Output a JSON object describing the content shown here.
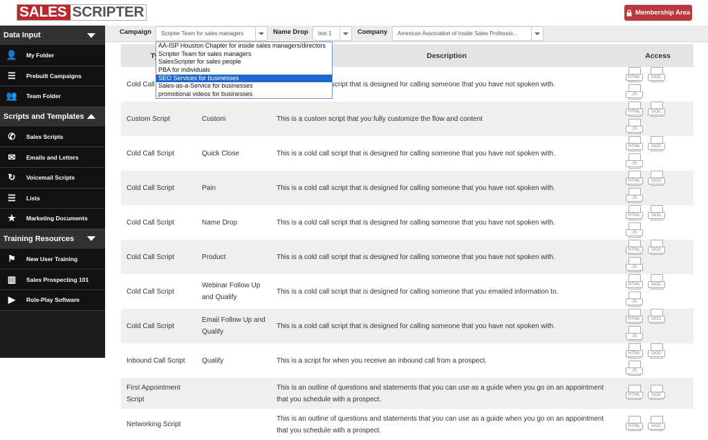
{
  "header": {
    "logo_part1": "SALES",
    "logo_part2": "SCRIPTER",
    "membership_label": "Membership Area",
    "membership_icon": "lock-icon"
  },
  "sidebar": {
    "sections": [
      {
        "title": "Data Input",
        "arrow": "down",
        "items": [
          {
            "label": "My Folder",
            "icon": "user-icon"
          },
          {
            "label": "Prebuilt Campaigns",
            "icon": "list-icon"
          },
          {
            "label": "Team Folder",
            "icon": "team-icon"
          }
        ]
      },
      {
        "title": "Scripts and Templates",
        "arrow": "up",
        "items": [
          {
            "label": "Sales Scripts",
            "icon": "phone-icon"
          },
          {
            "label": "Emails and Letters",
            "icon": "envelope-icon"
          },
          {
            "label": "Voicemail Scripts",
            "icon": "voicemail-icon"
          },
          {
            "label": "Lists",
            "icon": "list-icon"
          },
          {
            "label": "Marketing Documents",
            "icon": "star-icon"
          }
        ]
      },
      {
        "title": "Training Resources",
        "arrow": "down",
        "items": [
          {
            "label": "New User Training",
            "icon": "flag-icon"
          },
          {
            "label": "Sales Prospecting 101",
            "icon": "sliders-icon"
          },
          {
            "label": "Role-Play Software",
            "icon": "play-icon"
          }
        ]
      }
    ]
  },
  "filters": {
    "campaign_label": "Campaign",
    "campaign_value": "Scripter Team for sales managers",
    "namedrop_label": "Name Drop",
    "namedrop_value": "test 1",
    "company_label": "Company",
    "company_value": "American Association of Inside Sales Professio..."
  },
  "campaign_options": [
    {
      "label": "AA-ISP Houston Chapter for inside sales managers/directors",
      "highlighted": false
    },
    {
      "label": "Scripter Team for sales managers",
      "highlighted": false
    },
    {
      "label": "SalesScripter for sales people",
      "highlighted": false
    },
    {
      "label": "PBA for individuals",
      "highlighted": false
    },
    {
      "label": "SEO Services for businesses",
      "highlighted": true
    },
    {
      "label": "Sales-as-a-Service for businesses",
      "highlighted": false
    },
    {
      "label": "promotional videos for businesses",
      "highlighted": false
    }
  ],
  "table": {
    "headers": [
      "Type",
      "",
      "Description",
      "Access"
    ],
    "rows": [
      {
        "type": "Cold Call Script",
        "name": "",
        "description": "This is a cold call script that is designed for calling someone that you have not spoken with.",
        "access": [
          "HTML",
          "DOC",
          "JS"
        ]
      },
      {
        "type": "Custom Script",
        "name": "Custom",
        "description": "This is a custom script that you fully customize the flow and content",
        "access": [
          "HTML",
          "DOC",
          "JS"
        ]
      },
      {
        "type": "Cold Call Script",
        "name": "Quick Close",
        "description": "This is a cold call script that is designed for calling someone that you have not spoken with.",
        "access": [
          "HTML",
          "DOC",
          "JS"
        ]
      },
      {
        "type": "Cold Call Script",
        "name": "Pain",
        "description": "This is a cold call script that is designed for calling someone that you have not spoken with.",
        "access": [
          "HTML",
          "DOC",
          "JS"
        ]
      },
      {
        "type": "Cold Call Script",
        "name": "Name Drop",
        "description": "This is a cold call script that is designed for calling someone that you have not spoken with.",
        "access": [
          "HTML",
          "DOC",
          "JS"
        ]
      },
      {
        "type": "Cold Call Script",
        "name": "Product",
        "description": "This is a cold call script that is designed for calling someone that you have not spoken with.",
        "access": [
          "HTML",
          "DOC",
          "JS"
        ]
      },
      {
        "type": "Cold Call Script",
        "name": "Webinar Follow Up and Qualify",
        "description": "This is a cold call script that is designed for calling someone that you emailed information to.",
        "access": [
          "HTML",
          "DOC",
          "JS"
        ]
      },
      {
        "type": "Cold Call Script",
        "name": "Email Follow Up and Qualify",
        "description": "This is a cold call script that is designed for calling someone that you have not spoken with.",
        "access": [
          "HTML",
          "DOC",
          "JS"
        ]
      },
      {
        "type": "Inbound Call Script",
        "name": "Qualify",
        "description": "This is a script for when you receive an inbound call from a prospect.",
        "access": [
          "HTML",
          "DOC",
          "JS"
        ]
      },
      {
        "type": "First Appointment Script",
        "name": "",
        "description": "This is an outline of questions and statements that you can use as a guide when you go on an appointment that you schedule with a prospect.",
        "access": [
          "HTML",
          "DOC"
        ]
      },
      {
        "type": "Networking Script",
        "name": "",
        "description": "This is an outline of questions and statements that you can use as a guide when you go on an appointment that you schedule with a prospect.",
        "access": [
          "HTML",
          "DOC"
        ]
      }
    ]
  }
}
